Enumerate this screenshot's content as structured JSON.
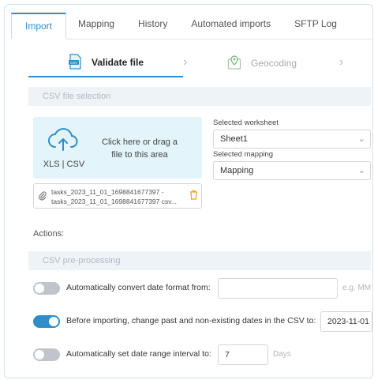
{
  "tabs": [
    "Import",
    "Mapping",
    "History",
    "Automated imports",
    "SFTP Log"
  ],
  "steps": {
    "validate": "Validate file",
    "geocoding": "Geocoding"
  },
  "sections": {
    "csv_selection": "CSV file selection",
    "csv_preprocessing": "CSV pre-processing"
  },
  "dropzone": {
    "format": "XLS | CSV",
    "text": "Click here or drag a file to this area"
  },
  "file": {
    "name_line1": "tasks_2023_11_01_1698841677397 -",
    "name_line2": "tasks_2023_11_01_1698841677397 csv..."
  },
  "worksheet": {
    "label": "Selected worksheet",
    "value": "Sheet1"
  },
  "mapping": {
    "label": "Selected mapping",
    "value": "Mapping"
  },
  "actions_label": "Actions:",
  "options": [
    {
      "label": "Automatically convert date format from:",
      "value": "",
      "hint": "e.g. MM",
      "enabled": false
    },
    {
      "label": "Before importing, change past and non-existing dates in the CSV to:",
      "value": "2023-11-01",
      "enabled": true
    },
    {
      "label": "Automatically set date range interval to:",
      "value": "7",
      "hint": "Days",
      "enabled": false
    }
  ],
  "colors": {
    "accent": "#2f8ec9",
    "dropzone": "#e3f4fa",
    "section": "#eef3f8"
  },
  "icons": [
    "csv-file-icon",
    "map-pin-icon",
    "cloud-upload-icon",
    "paperclip-icon",
    "trash-icon",
    "chevron-right-icon",
    "chevron-down-icon"
  ]
}
